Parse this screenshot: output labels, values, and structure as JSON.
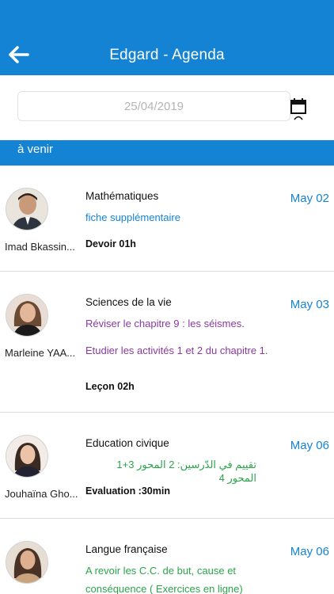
{
  "header": {
    "title": "Edgard - Agenda",
    "back_icon": "arrow-left-icon"
  },
  "date_field": {
    "value": "25/04/2019",
    "icon": "calendar-icon"
  },
  "section": {
    "label": "à venir"
  },
  "items": [
    {
      "teacher": "Imad Bkassin...",
      "subject": "Mathématiques",
      "date": "May 02",
      "lines": [
        "fiche supplémentaire"
      ],
      "line_color": "#1583d3",
      "tag": "Devoir 01h"
    },
    {
      "teacher": "Marleine YAA...",
      "subject": "Sciences de la vie",
      "date": "May 03",
      "lines": [
        "Réviser le chapitre 9 : les séismes.",
        "Etudier les activités 1 et 2 du chapitre 1."
      ],
      "line_color": "#8a3aa0",
      "tag": "Leçon 02h"
    },
    {
      "teacher": "Jouhaïna Gho...",
      "subject": "Education civique",
      "date": "May 06",
      "lines": [
        "تقييم في الدّرسين: 2 المحور 3+1 المحور 4"
      ],
      "line_color": "#2aa54a",
      "tag": "Evaluation :30min"
    },
    {
      "teacher": "",
      "subject": "Langue française",
      "date": "May 06",
      "lines": [
        "A revoir les C.C. de but, cause et",
        "conséquence ( Exercices en ligne)"
      ],
      "line_color": "#2aa54a",
      "tag": ""
    }
  ]
}
